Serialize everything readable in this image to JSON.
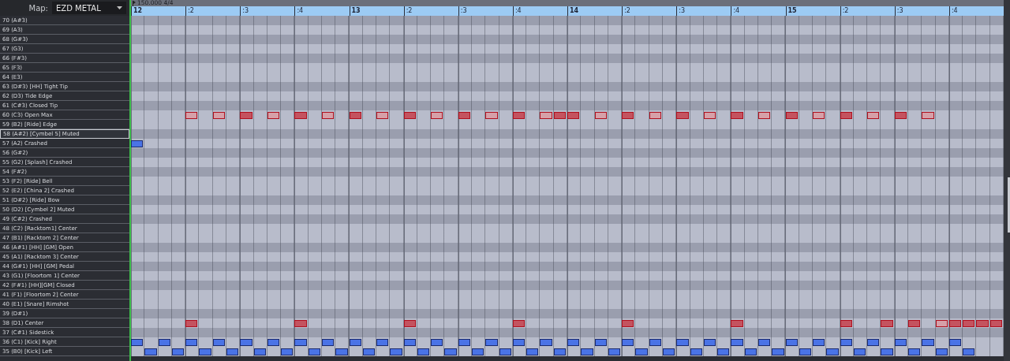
{
  "map": {
    "label": "Map:",
    "value": "EZD METAL"
  },
  "tempo": "150.000 4/4",
  "ruler": [
    ":2",
    ":3",
    ":4",
    "13",
    ":2",
    ":3",
    ":4",
    "14",
    ":2",
    ":3",
    ":4",
    "15",
    ":2",
    ":3",
    ":4"
  ],
  "ruler_start": "12",
  "rows": [
    {
      "label": "70 (A#3)",
      "black_key": true,
      "selected": false
    },
    {
      "label": "69 (A3)",
      "black_key": false,
      "selected": false
    },
    {
      "label": "68 (G#3)",
      "black_key": true,
      "selected": false
    },
    {
      "label": "67 (G3)",
      "black_key": false,
      "selected": false
    },
    {
      "label": "66 (F#3)",
      "black_key": true,
      "selected": false
    },
    {
      "label": "65 (F3)",
      "black_key": false,
      "selected": false
    },
    {
      "label": "64 (E3)",
      "black_key": false,
      "selected": false
    },
    {
      "label": "63 (D#3) [HH] Tight Tip",
      "black_key": true,
      "selected": false
    },
    {
      "label": "62 (D3) Tide Edge",
      "black_key": false,
      "selected": false
    },
    {
      "label": "61 (C#3) Closed Tip",
      "black_key": true,
      "selected": false
    },
    {
      "label": "60 (C3) Open Max",
      "black_key": false,
      "selected": false,
      "steps": [
        {
          "kind": "rest"
        },
        {
          "kind": "rest"
        },
        {
          "kind": "rest"
        },
        {
          "kind": "rest"
        },
        {
          "kind": "note",
          "selected": true,
          "accent": false
        },
        {
          "kind": "rest"
        },
        {
          "kind": "note",
          "selected": true,
          "accent": false
        },
        {
          "kind": "rest"
        },
        {
          "kind": "note",
          "selected": true,
          "accent": true
        },
        {
          "kind": "rest"
        },
        {
          "kind": "note",
          "selected": true,
          "accent": false
        },
        {
          "kind": "rest"
        },
        {
          "kind": "note",
          "selected": true,
          "accent": true
        },
        {
          "kind": "rest"
        },
        {
          "kind": "note",
          "selected": true,
          "accent": false
        },
        {
          "kind": "rest"
        },
        {
          "kind": "note",
          "selected": true,
          "accent": true
        },
        {
          "kind": "rest"
        },
        {
          "kind": "note",
          "selected": true,
          "accent": false
        },
        {
          "kind": "rest"
        },
        {
          "kind": "note",
          "selected": true,
          "accent": true
        },
        {
          "kind": "rest"
        },
        {
          "kind": "note",
          "selected": true,
          "accent": false
        },
        {
          "kind": "rest"
        },
        {
          "kind": "note",
          "selected": true,
          "accent": true
        },
        {
          "kind": "rest"
        },
        {
          "kind": "note",
          "selected": true,
          "accent": false
        },
        {
          "kind": "rest"
        },
        {
          "kind": "note",
          "selected": true,
          "accent": true
        },
        {
          "kind": "rest"
        },
        {
          "kind": "note",
          "selected": true,
          "accent": false
        },
        {
          "kind": "note",
          "selected": true,
          "accent": true
        },
        {
          "kind": "note",
          "selected": true,
          "accent": true
        },
        {
          "kind": "rest"
        },
        {
          "kind": "note",
          "selected": true,
          "accent": false
        },
        {
          "kind": "rest"
        },
        {
          "kind": "note",
          "selected": true,
          "accent": true
        },
        {
          "kind": "rest"
        },
        {
          "kind": "note",
          "selected": true,
          "accent": false
        },
        {
          "kind": "rest"
        },
        {
          "kind": "note",
          "selected": true,
          "accent": true
        },
        {
          "kind": "rest"
        },
        {
          "kind": "note",
          "selected": true,
          "accent": false
        },
        {
          "kind": "rest"
        },
        {
          "kind": "note",
          "selected": true,
          "accent": true
        },
        {
          "kind": "rest"
        },
        {
          "kind": "note",
          "selected": true,
          "accent": false
        },
        {
          "kind": "rest"
        },
        {
          "kind": "note",
          "selected": true,
          "accent": true
        },
        {
          "kind": "rest"
        },
        {
          "kind": "note",
          "selected": true,
          "accent": false
        },
        {
          "kind": "rest"
        },
        {
          "kind": "note",
          "selected": true,
          "accent": true
        },
        {
          "kind": "rest"
        },
        {
          "kind": "note",
          "selected": true,
          "accent": false
        },
        {
          "kind": "rest"
        },
        {
          "kind": "note",
          "selected": true,
          "accent": true
        },
        {
          "kind": "rest"
        },
        {
          "kind": "note",
          "selected": true,
          "accent": false
        }
      ]
    },
    {
      "label": "59 (B2) [Ride] Edge",
      "black_key": false,
      "selected": false
    },
    {
      "label": "58 (A#2) [Cymbel 5] Muted",
      "black_key": true,
      "selected": true
    },
    {
      "label": "57 (A2) Crashed",
      "black_key": false,
      "selected": false,
      "steps": [
        {
          "kind": "note",
          "selected": false,
          "accent": true
        }
      ]
    },
    {
      "label": "56 (G#2)",
      "black_key": true,
      "selected": false
    },
    {
      "label": "55 (G2) [Splash] Crashed",
      "black_key": false,
      "selected": false
    },
    {
      "label": "54 (F#2)",
      "black_key": true,
      "selected": false
    },
    {
      "label": "53 (F2) [Ride] Bell",
      "black_key": false,
      "selected": false
    },
    {
      "label": "52 (E2) [China 2] Crashed",
      "black_key": false,
      "selected": false
    },
    {
      "label": "51 (D#2) [Ride] Bow",
      "black_key": true,
      "selected": false
    },
    {
      "label": "50 (D2) [Cymbel 2] Muted",
      "black_key": false,
      "selected": false
    },
    {
      "label": "49 (C#2) Crashed",
      "black_key": true,
      "selected": false
    },
    {
      "label": "48 (C2) [Racktom1] Center",
      "black_key": false,
      "selected": false
    },
    {
      "label": "47 (B1) [Racktom 2] Center",
      "black_key": false,
      "selected": false
    },
    {
      "label": "46 (A#1) [HH] [GM] Open",
      "black_key": true,
      "selected": false
    },
    {
      "label": "45 (A1) [Racktom 3] Center",
      "black_key": false,
      "selected": false
    },
    {
      "label": "44 (G#1) [HH] [GM] Pedal",
      "black_key": true,
      "selected": false
    },
    {
      "label": "43 (G1) [Floortom 1] Center",
      "black_key": false,
      "selected": false
    },
    {
      "label": "42 (F#1) [HH][GM] Closed",
      "black_key": true,
      "selected": false
    },
    {
      "label": "41 (F1) [Floortom 2] Center",
      "black_key": false,
      "selected": false
    },
    {
      "label": "40 (E1) [Snare] Rimshot",
      "black_key": false,
      "selected": false
    },
    {
      "label": "39 (D#1)",
      "black_key": true,
      "selected": false
    },
    {
      "label": "38 (D1) Center",
      "black_key": false,
      "selected": false,
      "steps": [
        {
          "kind": "rest"
        },
        {
          "kind": "rest"
        },
        {
          "kind": "rest"
        },
        {
          "kind": "rest"
        },
        {
          "kind": "note",
          "selected": true,
          "accent": true
        },
        {
          "kind": "rest"
        },
        {
          "kind": "rest"
        },
        {
          "kind": "rest"
        },
        {
          "kind": "rest"
        },
        {
          "kind": "rest"
        },
        {
          "kind": "rest"
        },
        {
          "kind": "rest"
        },
        {
          "kind": "note",
          "selected": true,
          "accent": true
        },
        {
          "kind": "rest"
        },
        {
          "kind": "rest"
        },
        {
          "kind": "rest"
        },
        {
          "kind": "rest"
        },
        {
          "kind": "rest"
        },
        {
          "kind": "rest"
        },
        {
          "kind": "rest"
        },
        {
          "kind": "note",
          "selected": true,
          "accent": true
        },
        {
          "kind": "rest"
        },
        {
          "kind": "rest"
        },
        {
          "kind": "rest"
        },
        {
          "kind": "rest"
        },
        {
          "kind": "rest"
        },
        {
          "kind": "rest"
        },
        {
          "kind": "rest"
        },
        {
          "kind": "note",
          "selected": true,
          "accent": true
        },
        {
          "kind": "rest"
        },
        {
          "kind": "rest"
        },
        {
          "kind": "rest"
        },
        {
          "kind": "rest"
        },
        {
          "kind": "rest"
        },
        {
          "kind": "rest"
        },
        {
          "kind": "rest"
        },
        {
          "kind": "note",
          "selected": true,
          "accent": true
        },
        {
          "kind": "rest"
        },
        {
          "kind": "rest"
        },
        {
          "kind": "rest"
        },
        {
          "kind": "rest"
        },
        {
          "kind": "rest"
        },
        {
          "kind": "rest"
        },
        {
          "kind": "rest"
        },
        {
          "kind": "note",
          "selected": true,
          "accent": true
        },
        {
          "kind": "rest"
        },
        {
          "kind": "rest"
        },
        {
          "kind": "rest"
        },
        {
          "kind": "rest"
        },
        {
          "kind": "rest"
        },
        {
          "kind": "rest"
        },
        {
          "kind": "rest"
        },
        {
          "kind": "note",
          "selected": true,
          "accent": true
        },
        {
          "kind": "rest"
        },
        {
          "kind": "rest"
        },
        {
          "kind": "note",
          "selected": true,
          "accent": true
        },
        {
          "kind": "rest"
        },
        {
          "kind": "note",
          "selected": true,
          "accent": true
        },
        {
          "kind": "rest"
        },
        {
          "kind": "note",
          "selected": true,
          "accent": false
        },
        {
          "kind": "note",
          "selected": true,
          "accent": true
        },
        {
          "kind": "note",
          "selected": true,
          "accent": true
        },
        {
          "kind": "note",
          "selected": true,
          "accent": true
        },
        {
          "kind": "note",
          "selected": true,
          "accent": true
        }
      ]
    },
    {
      "label": "37 (C#1) Sidestick",
      "black_key": true,
      "selected": false
    },
    {
      "label": "36 (C1) [Kick] Right",
      "black_key": false,
      "selected": false,
      "steps": [
        {
          "kind": "note",
          "selected": false,
          "accent": true
        },
        {
          "kind": "rest"
        },
        {
          "kind": "note",
          "selected": false,
          "accent": true
        },
        {
          "kind": "rest"
        },
        {
          "kind": "note",
          "selected": false,
          "accent": true
        },
        {
          "kind": "rest"
        },
        {
          "kind": "note",
          "selected": false,
          "accent": true
        },
        {
          "kind": "rest"
        },
        {
          "kind": "note",
          "selected": false,
          "accent": true
        },
        {
          "kind": "rest"
        },
        {
          "kind": "note",
          "selected": false,
          "accent": true
        },
        {
          "kind": "rest"
        },
        {
          "kind": "note",
          "selected": false,
          "accent": true
        },
        {
          "kind": "rest"
        },
        {
          "kind": "note",
          "selected": false,
          "accent": true
        },
        {
          "kind": "rest"
        },
        {
          "kind": "note",
          "selected": false,
          "accent": true
        },
        {
          "kind": "rest"
        },
        {
          "kind": "note",
          "selected": false,
          "accent": true
        },
        {
          "kind": "rest"
        },
        {
          "kind": "note",
          "selected": false,
          "accent": true
        },
        {
          "kind": "rest"
        },
        {
          "kind": "note",
          "selected": false,
          "accent": true
        },
        {
          "kind": "rest"
        },
        {
          "kind": "note",
          "selected": false,
          "accent": true
        },
        {
          "kind": "rest"
        },
        {
          "kind": "note",
          "selected": false,
          "accent": true
        },
        {
          "kind": "rest"
        },
        {
          "kind": "note",
          "selected": false,
          "accent": true
        },
        {
          "kind": "rest"
        },
        {
          "kind": "note",
          "selected": false,
          "accent": true
        },
        {
          "kind": "rest"
        },
        {
          "kind": "note",
          "selected": false,
          "accent": true
        },
        {
          "kind": "rest"
        },
        {
          "kind": "note",
          "selected": false,
          "accent": true
        },
        {
          "kind": "rest"
        },
        {
          "kind": "note",
          "selected": false,
          "accent": true
        },
        {
          "kind": "rest"
        },
        {
          "kind": "note",
          "selected": false,
          "accent": true
        },
        {
          "kind": "rest"
        },
        {
          "kind": "note",
          "selected": false,
          "accent": true
        },
        {
          "kind": "rest"
        },
        {
          "kind": "note",
          "selected": false,
          "accent": true
        },
        {
          "kind": "rest"
        },
        {
          "kind": "note",
          "selected": false,
          "accent": true
        },
        {
          "kind": "rest"
        },
        {
          "kind": "note",
          "selected": false,
          "accent": true
        },
        {
          "kind": "rest"
        },
        {
          "kind": "note",
          "selected": false,
          "accent": true
        },
        {
          "kind": "rest"
        },
        {
          "kind": "note",
          "selected": false,
          "accent": true
        },
        {
          "kind": "rest"
        },
        {
          "kind": "note",
          "selected": false,
          "accent": true
        },
        {
          "kind": "rest"
        },
        {
          "kind": "note",
          "selected": false,
          "accent": true
        },
        {
          "kind": "rest"
        },
        {
          "kind": "note",
          "selected": false,
          "accent": true
        },
        {
          "kind": "rest"
        },
        {
          "kind": "note",
          "selected": false,
          "accent": true
        },
        {
          "kind": "rest"
        },
        {
          "kind": "note",
          "selected": false,
          "accent": true
        }
      ]
    },
    {
      "label": "35 (B0) [Kick] Left",
      "black_key": false,
      "selected": false,
      "steps": [
        {
          "kind": "rest"
        },
        {
          "kind": "note",
          "selected": false,
          "accent": true
        },
        {
          "kind": "rest"
        },
        {
          "kind": "note",
          "selected": false,
          "accent": true
        },
        {
          "kind": "rest"
        },
        {
          "kind": "note",
          "selected": false,
          "accent": true
        },
        {
          "kind": "rest"
        },
        {
          "kind": "note",
          "selected": false,
          "accent": true
        },
        {
          "kind": "rest"
        },
        {
          "kind": "note",
          "selected": false,
          "accent": true
        },
        {
          "kind": "rest"
        },
        {
          "kind": "note",
          "selected": false,
          "accent": true
        },
        {
          "kind": "rest"
        },
        {
          "kind": "note",
          "selected": false,
          "accent": true
        },
        {
          "kind": "rest"
        },
        {
          "kind": "note",
          "selected": false,
          "accent": true
        },
        {
          "kind": "rest"
        },
        {
          "kind": "note",
          "selected": false,
          "accent": true
        },
        {
          "kind": "rest"
        },
        {
          "kind": "note",
          "selected": false,
          "accent": true
        },
        {
          "kind": "rest"
        },
        {
          "kind": "note",
          "selected": false,
          "accent": true
        },
        {
          "kind": "rest"
        },
        {
          "kind": "note",
          "selected": false,
          "accent": true
        },
        {
          "kind": "rest"
        },
        {
          "kind": "note",
          "selected": false,
          "accent": true
        },
        {
          "kind": "rest"
        },
        {
          "kind": "note",
          "selected": false,
          "accent": true
        },
        {
          "kind": "rest"
        },
        {
          "kind": "note",
          "selected": false,
          "accent": true
        },
        {
          "kind": "rest"
        },
        {
          "kind": "note",
          "selected": false,
          "accent": true
        },
        {
          "kind": "rest"
        },
        {
          "kind": "note",
          "selected": false,
          "accent": true
        },
        {
          "kind": "rest"
        },
        {
          "kind": "note",
          "selected": false,
          "accent": true
        },
        {
          "kind": "rest"
        },
        {
          "kind": "note",
          "selected": false,
          "accent": true
        },
        {
          "kind": "rest"
        },
        {
          "kind": "note",
          "selected": false,
          "accent": true
        },
        {
          "kind": "rest"
        },
        {
          "kind": "note",
          "selected": false,
          "accent": true
        },
        {
          "kind": "rest"
        },
        {
          "kind": "note",
          "selected": false,
          "accent": true
        },
        {
          "kind": "rest"
        },
        {
          "kind": "note",
          "selected": false,
          "accent": true
        },
        {
          "kind": "rest"
        },
        {
          "kind": "note",
          "selected": false,
          "accent": true
        },
        {
          "kind": "rest"
        },
        {
          "kind": "note",
          "selected": false,
          "accent": true
        },
        {
          "kind": "rest"
        },
        {
          "kind": "note",
          "selected": false,
          "accent": true
        },
        {
          "kind": "rest"
        },
        {
          "kind": "note",
          "selected": false,
          "accent": true
        },
        {
          "kind": "rest"
        },
        {
          "kind": "note",
          "selected": false,
          "accent": true
        },
        {
          "kind": "rest"
        },
        {
          "kind": "note",
          "selected": false,
          "accent": true
        },
        {
          "kind": "rest"
        },
        {
          "kind": "note",
          "selected": false,
          "accent": true
        },
        {
          "kind": "rest"
        },
        {
          "kind": "note",
          "selected": false,
          "accent": true
        }
      ]
    }
  ]
}
